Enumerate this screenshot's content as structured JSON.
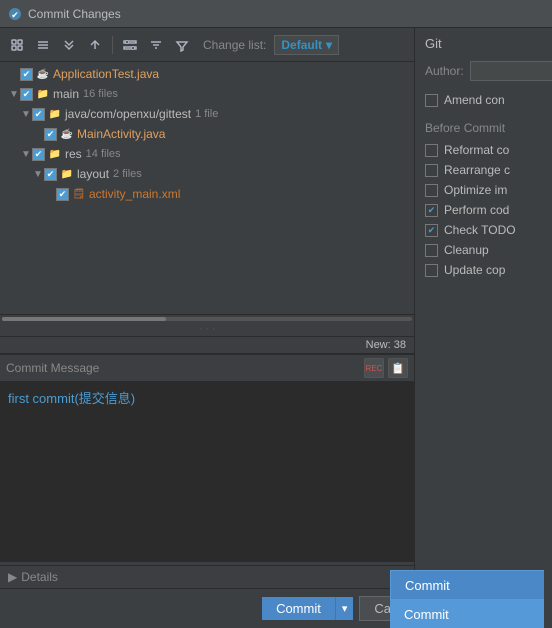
{
  "titleBar": {
    "title": "Commit Changes",
    "icon": "✔"
  },
  "toolbar": {
    "changeListLabel": "Change list:",
    "changeListValue": "Default",
    "buttons": [
      "↩",
      "↺",
      "↻",
      "⬆",
      "☰",
      "⇅",
      "⇌"
    ]
  },
  "fileTree": {
    "items": [
      {
        "indent": 8,
        "arrow": "",
        "checked": "checked",
        "icon": "📄",
        "iconClass": "java",
        "label": "ApplicationTest.java",
        "count": ""
      },
      {
        "indent": 8,
        "arrow": "▼",
        "checked": "checked",
        "icon": "📁",
        "iconClass": "folder",
        "label": "main",
        "count": "16 files"
      },
      {
        "indent": 20,
        "arrow": "▼",
        "checked": "checked",
        "icon": "📁",
        "iconClass": "folder",
        "label": "java/com/openxu/gittest",
        "count": "1 file"
      },
      {
        "indent": 32,
        "arrow": "",
        "checked": "checked",
        "icon": "📄",
        "iconClass": "java",
        "label": "MainActivity.java",
        "count": ""
      },
      {
        "indent": 20,
        "arrow": "▼",
        "checked": "checked",
        "icon": "📁",
        "iconClass": "folder",
        "label": "res",
        "count": "14 files"
      },
      {
        "indent": 32,
        "arrow": "▼",
        "checked": "checked",
        "icon": "📁",
        "iconClass": "folder",
        "label": "layout",
        "count": "2 files"
      },
      {
        "indent": 44,
        "arrow": "",
        "checked": "checked",
        "icon": "📄",
        "iconClass": "xml",
        "label": "activity_main.xml",
        "count": ""
      }
    ]
  },
  "newCounter": {
    "label": "New:",
    "value": "38"
  },
  "commitMessage": {
    "sectionLabel": "Commit Message",
    "text": "first commit(提交信息)",
    "icons": [
      "REC",
      "📋"
    ]
  },
  "details": {
    "label": "Details",
    "dotsLabel": "..."
  },
  "rightPanel": {
    "gitLabel": "Git",
    "authorLabel": "Author:",
    "authorPlaceholder": "",
    "amendLabel": "Amend con",
    "beforeCommitTitle": "Before Commit",
    "options": [
      {
        "label": "Reformat co",
        "checked": false
      },
      {
        "label": "Rearrange c",
        "checked": false
      },
      {
        "label": "Optimize im",
        "checked": false
      },
      {
        "label": "Perform cod",
        "checked": true
      },
      {
        "label": "Check TODO",
        "checked": true
      },
      {
        "label": "Cleanup",
        "checked": false
      },
      {
        "label": "Update cop",
        "checked": false
      }
    ]
  },
  "bottomBar": {
    "commitLabel": "Commit",
    "commitArrow": "▾",
    "cancelLabel": "Ca"
  },
  "commitDropdown": {
    "item": "Commit"
  }
}
